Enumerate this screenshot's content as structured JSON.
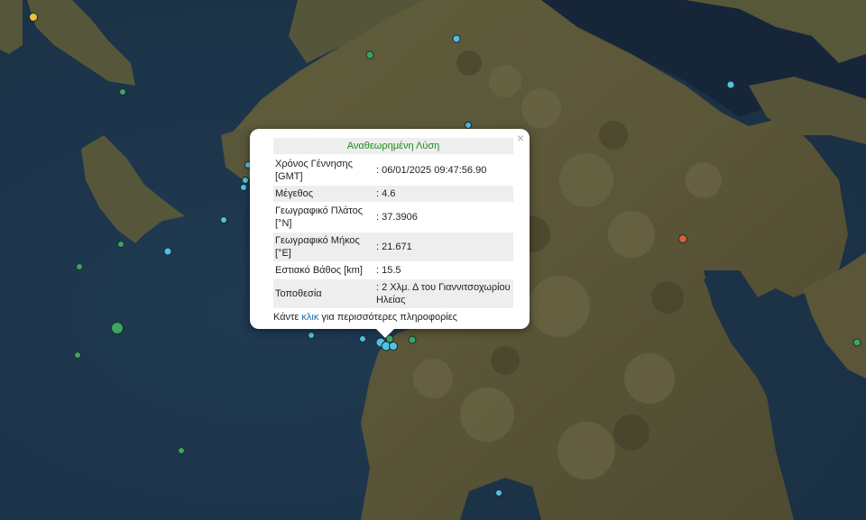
{
  "popup": {
    "title": "Αναθεωρημένη Λύση",
    "close_icon": "×",
    "rows": [
      {
        "label": "Χρόνος Γέννησης [GMT]",
        "value": ": 06/01/2025 09:47:56.90"
      },
      {
        "label": "Μέγεθος",
        "value": ": 4.6"
      },
      {
        "label": "Γεωγραφικό Πλάτος [°N]",
        "value": ": 37.3906"
      },
      {
        "label": "Γεωγραφικό Μήκος [°E]",
        "value": ": 21.671"
      },
      {
        "label": "Εστιακό Βάθος [km]",
        "value": ": 15.5"
      },
      {
        "label": "Τοποθεσία",
        "value": ": 2 Χλμ. Δ του Γιαννιτσοχωρίου Ηλείας"
      }
    ],
    "footer_prefix": "Κάντε ",
    "footer_link": "κλικ",
    "footer_suffix": " για περισσότερες πληροφορίες"
  },
  "colors": {
    "sea": "#22384f",
    "land": "#5d5a3a",
    "marker_cyan": "#4fc3e0",
    "marker_green": "#3da55d",
    "marker_yellow": "#e8c33a",
    "marker_orange": "#e0602a"
  }
}
